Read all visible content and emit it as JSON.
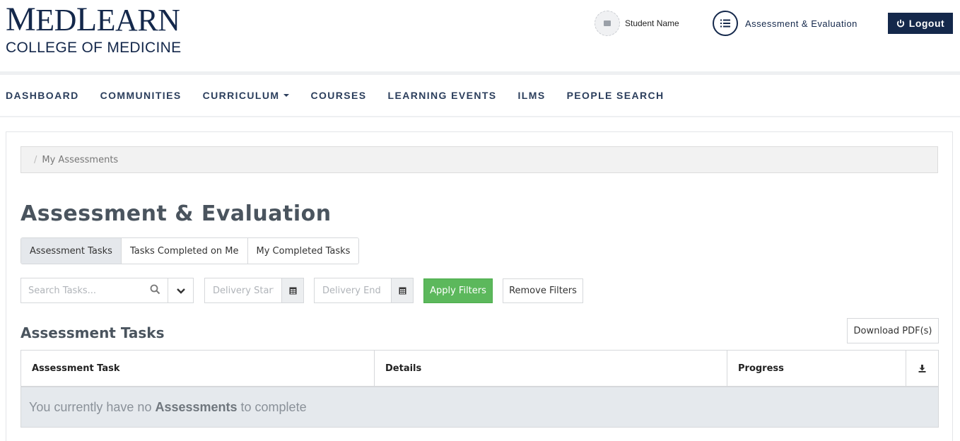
{
  "header": {
    "logo_main_first": "M",
    "logo_main_rest": "ED",
    "logo_main_second": "L",
    "logo_main_tail": "EARN",
    "logo_sub": "COLLEGE OF MEDICINE",
    "user_name": "Student Name",
    "ae_label": "Assessment & Evaluation",
    "logout_label": "Logout",
    "brand_color": "#14284b"
  },
  "nav": {
    "items": [
      {
        "label": "DASHBOARD"
      },
      {
        "label": "COMMUNITIES"
      },
      {
        "label": "CURRICULUM"
      },
      {
        "label": "COURSES"
      },
      {
        "label": "LEARNING EVENTS"
      },
      {
        "label": "ILMS"
      },
      {
        "label": "PEOPLE SEARCH"
      }
    ]
  },
  "breadcrumb": {
    "separator": "/",
    "current": "My Assessments"
  },
  "page_title": "Assessment & Evaluation",
  "tabs": [
    {
      "label": "Assessment Tasks",
      "active": true
    },
    {
      "label": "Tasks Completed on Me",
      "active": false
    },
    {
      "label": "My Completed Tasks",
      "active": false
    }
  ],
  "filters": {
    "search_placeholder": "Search Tasks...",
    "delivery_start_placeholder": "Delivery Start",
    "delivery_end_placeholder": "Delivery End",
    "apply_label": "Apply Filters",
    "remove_label": "Remove Filters",
    "apply_color": "#5cb85c"
  },
  "section": {
    "title": "Assessment Tasks",
    "download_label": "Download PDF(s)"
  },
  "table": {
    "columns": [
      "Assessment Task",
      "Details",
      "Progress"
    ],
    "empty_prefix": "You currently have no ",
    "empty_bold": "Assessments",
    "empty_suffix": " to complete"
  }
}
